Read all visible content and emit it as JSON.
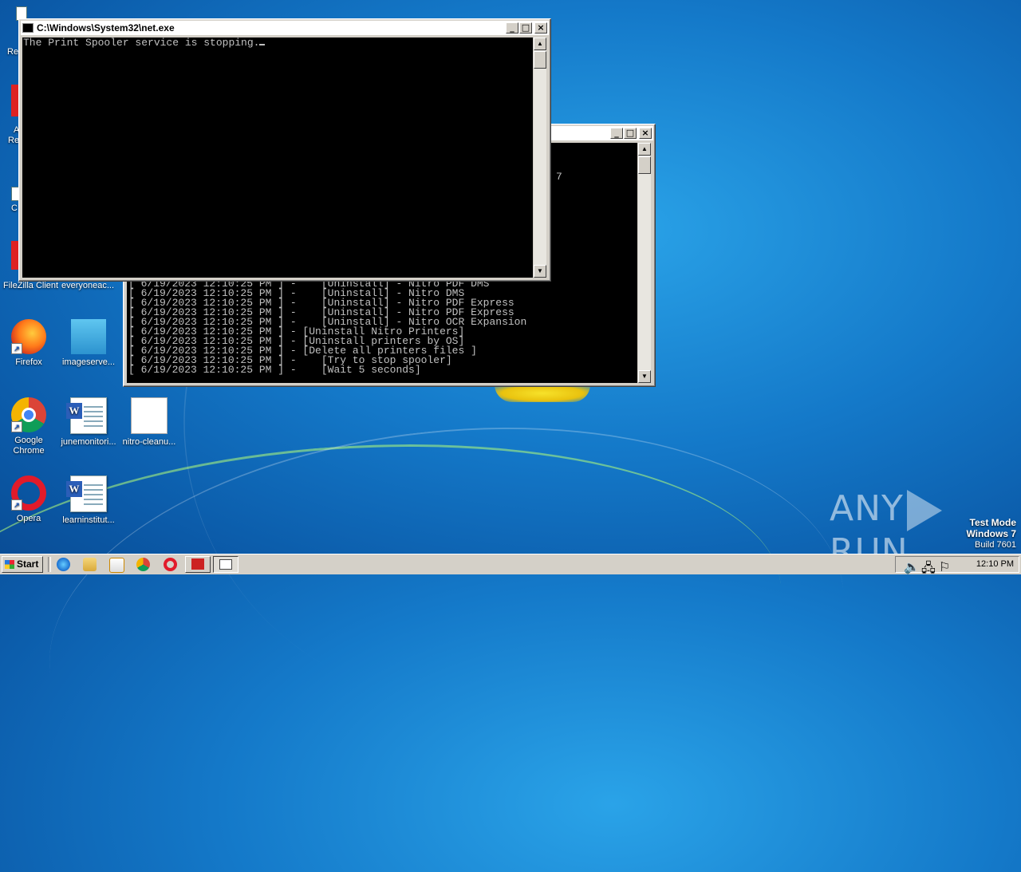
{
  "desktop": {
    "icons": [
      {
        "name": "firefox",
        "label": "Firefox"
      },
      {
        "name": "imageserver",
        "label": "imageserve..."
      },
      {
        "name": "chrome",
        "label": "Google Chrome"
      },
      {
        "name": "junemonitor",
        "label": "junemonitori..."
      },
      {
        "name": "nitrocleanup",
        "label": "nitro-cleanu..."
      },
      {
        "name": "opera",
        "label": "Opera"
      },
      {
        "name": "learninstitut",
        "label": "learninstitut..."
      },
      {
        "name": "filezilla",
        "label": "FileZilla Client"
      },
      {
        "name": "everyoneac",
        "label": "everyoneac..."
      }
    ],
    "partial_labels": {
      "recycle": "Re",
      "acrobat_a": "A",
      "acrobat_re": "Re",
      "c": "C"
    }
  },
  "front_window": {
    "title": "C:\\Windows\\System32\\net.exe",
    "console_text": "The Print Spooler service is stopping.",
    "buttons": {
      "minimize": "_",
      "maximize": "□",
      "close": "×"
    }
  },
  "back_window": {
    "stray_char": "7",
    "lines": [
      "[ 6/19/2023 12:10:25 PM ] -    [Uninstall] - Nitro PDF DMS",
      "[ 6/19/2023 12:10:25 PM ] -    [Uninstall] - Nitro DMS",
      "[ 6/19/2023 12:10:25 PM ] -    [Uninstall] - Nitro PDF Express",
      "[ 6/19/2023 12:10:25 PM ] -    [Uninstall] - Nitro PDF Express",
      "[ 6/19/2023 12:10:25 PM ] -    [Uninstall] - Nitro OCR Expansion",
      "[ 6/19/2023 12:10:25 PM ] - [Uninstall Nitro Printers]",
      "[ 6/19/2023 12:10:25 PM ] - [Uninstall printers by OS]",
      "[ 6/19/2023 12:10:25 PM ] - [Delete all printers files ]",
      "[ 6/19/2023 12:10:25 PM ] -    [Try to stop spooler]",
      "[ 6/19/2023 12:10:25 PM ] -    [Wait 5 seconds]"
    ],
    "buttons": {
      "minimize": "_",
      "maximize": "□",
      "close": "×"
    }
  },
  "taskbar": {
    "start_label": "Start",
    "clock": "12:10 PM"
  },
  "watermark": {
    "left": "ANY",
    "right": "RUN"
  },
  "test_mode": {
    "line1": "Test Mode",
    "line2": "Windows 7",
    "line3": "Build 7601"
  },
  "colors": {
    "console_bg": "#000000",
    "console_text": "#c0c0c0",
    "chrome_gray": "#d4d0c8"
  }
}
